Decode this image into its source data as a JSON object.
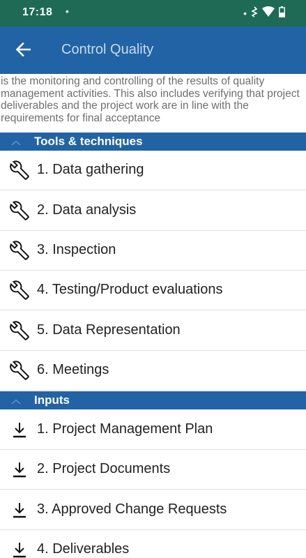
{
  "status_bar": {
    "time": "17:18",
    "dot": "•",
    "right_dot": "•",
    "icons": [
      "vibrate-icon",
      "wifi-icon",
      "battery-icon"
    ]
  },
  "app_bar": {
    "title": "Control Quality",
    "back_icon": "arrow-back-icon",
    "background_color": "#2163a5"
  },
  "description": "is the monitoring and controlling of the results of quality management activities. This also includes verifying that project deliverables and the project work are in line with the requirements for final acceptance",
  "sections": {
    "tools": {
      "title": "Tools & techniques",
      "items": [
        {
          "label": "1. Data gathering",
          "icon": "wrench-icon"
        },
        {
          "label": "2. Data analysis",
          "icon": "wrench-icon"
        },
        {
          "label": "3. Inspection",
          "icon": "wrench-icon"
        },
        {
          "label": "4. Testing/Product evaluations",
          "icon": "wrench-icon"
        },
        {
          "label": "5. Data Representation",
          "icon": "wrench-icon"
        },
        {
          "label": "6. Meetings",
          "icon": "wrench-icon"
        }
      ]
    },
    "inputs": {
      "title": "Inputs",
      "items": [
        {
          "label": "1. Project Management Plan",
          "icon": "download-icon"
        },
        {
          "label": "2. Project Documents",
          "icon": "download-icon"
        },
        {
          "label": "3. Approved Change Requests",
          "icon": "download-icon"
        },
        {
          "label": "4. Deliverables",
          "icon": "download-icon"
        }
      ]
    }
  }
}
